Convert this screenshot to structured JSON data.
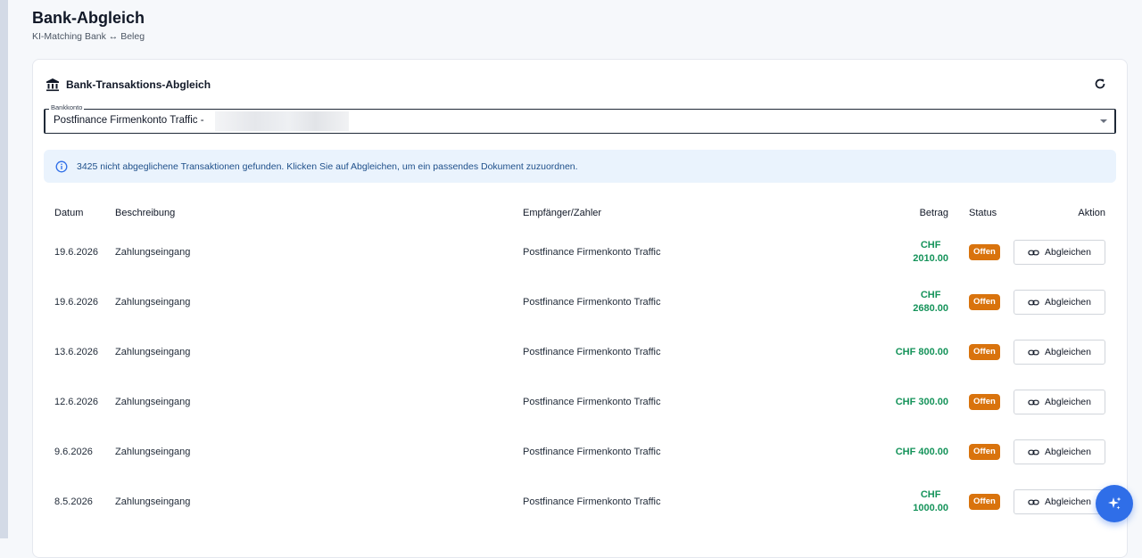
{
  "page": {
    "title": "Bank-Abgleich",
    "subtitle": "KI-Matching Bank ↔ Beleg"
  },
  "card": {
    "title": "Bank-Transaktions-Abgleich",
    "bank_icon": "bank-icon",
    "refresh_icon": "refresh-icon"
  },
  "bank_select": {
    "label": "Bankkonto",
    "value": "Postfinance Firmenkonto Traffic -"
  },
  "info": {
    "icon": "info-icon",
    "text": "3425 nicht abgeglichene Transaktionen gefunden. Klicken Sie auf Abgleichen, um ein passendes Dokument zuzuordnen."
  },
  "table": {
    "headers": {
      "date": "Datum",
      "description": "Beschreibung",
      "payee": "Empfänger/Zahler",
      "amount": "Betrag",
      "status": "Status",
      "action": "Aktion"
    },
    "rows": [
      {
        "date": "19.6.2026",
        "description": "Zahlungseingang",
        "payee": "Postfinance Firmenkonto Traffic",
        "amount_line1": "CHF",
        "amount_line2": "2010.00",
        "status": "Offen",
        "action": "Abgleichen"
      },
      {
        "date": "19.6.2026",
        "description": "Zahlungseingang",
        "payee": "Postfinance Firmenkonto Traffic",
        "amount_line1": "CHF",
        "amount_line2": "2680.00",
        "status": "Offen",
        "action": "Abgleichen"
      },
      {
        "date": "13.6.2026",
        "description": "Zahlungseingang",
        "payee": "Postfinance Firmenkonto Traffic",
        "amount_line1": "CHF 800.00",
        "amount_line2": "",
        "status": "Offen",
        "action": "Abgleichen"
      },
      {
        "date": "12.6.2026",
        "description": "Zahlungseingang",
        "payee": "Postfinance Firmenkonto Traffic",
        "amount_line1": "CHF 300.00",
        "amount_line2": "",
        "status": "Offen",
        "action": "Abgleichen"
      },
      {
        "date": "9.6.2026",
        "description": "Zahlungseingang",
        "payee": "Postfinance Firmenkonto Traffic",
        "amount_line1": "CHF 400.00",
        "amount_line2": "",
        "status": "Offen",
        "action": "Abgleichen"
      },
      {
        "date": "8.5.2026",
        "description": "Zahlungseingang",
        "payee": "Postfinance Firmenkonto Traffic",
        "amount_line1": "CHF",
        "amount_line2": "1000.00",
        "status": "Offen",
        "action": "Abgleichen"
      }
    ]
  },
  "fab": {
    "icon": "sparkles-icon"
  },
  "colors": {
    "amount": "#15935a",
    "status_badge": "#d9730d",
    "info_bg": "#eaf3fd",
    "fab": "#2f6ee8"
  }
}
